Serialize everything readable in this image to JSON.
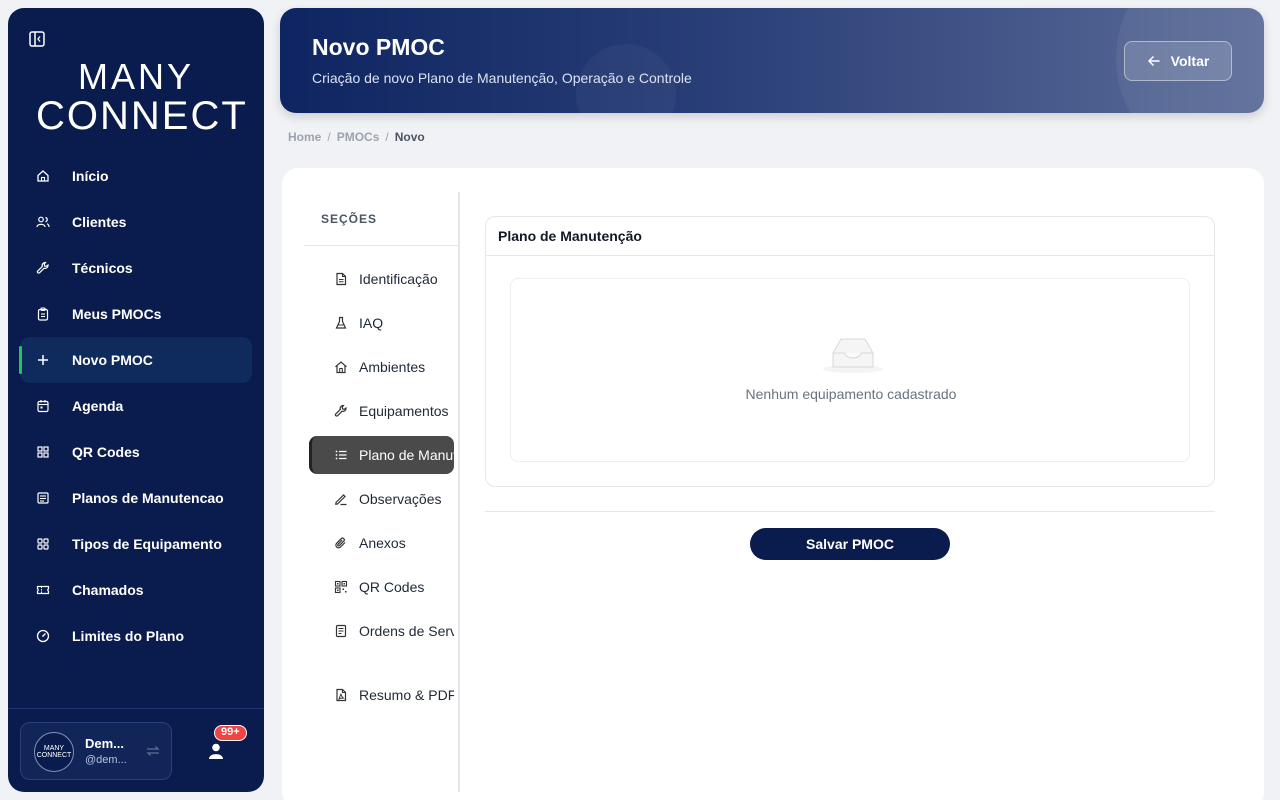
{
  "sidebar": {
    "logo": {
      "line1": "MANY",
      "line2": "CONNECT"
    },
    "nav": [
      {
        "label": "Início",
        "icon": "home-icon"
      },
      {
        "label": "Clientes",
        "icon": "users-icon"
      },
      {
        "label": "Técnicos",
        "icon": "wrench-icon"
      },
      {
        "label": "Meus PMOCs",
        "icon": "clipboard-icon"
      },
      {
        "label": "Novo PMOC",
        "icon": "plus-icon",
        "active": true
      },
      {
        "label": "Agenda",
        "icon": "calendar-icon"
      },
      {
        "label": "QR Codes",
        "icon": "qr-grid-icon"
      },
      {
        "label": "Planos de Manutencao",
        "icon": "list-icon"
      },
      {
        "label": "Tipos de Equipamento",
        "icon": "grid-icon"
      },
      {
        "label": "Chamados",
        "icon": "ticket-icon"
      },
      {
        "label": "Limites do Plano",
        "icon": "gauge-icon"
      }
    ],
    "user": {
      "avatar_line1": "MANY",
      "avatar_line2": "CONNECT",
      "name": "Dem...",
      "handle": "@dem...",
      "notifications": "99+"
    }
  },
  "header": {
    "title": "Novo PMOC",
    "subtitle": "Criação de novo Plano de Manutenção, Operação e Controle",
    "back_label": "Voltar"
  },
  "breadcrumb": {
    "home": "Home",
    "pmocs": "PMOCs",
    "current": "Novo",
    "sep": "/"
  },
  "sections": {
    "title": "SEÇÕES",
    "items": [
      {
        "label": "Identificação",
        "icon": "document-icon"
      },
      {
        "label": "IAQ",
        "icon": "flask-icon"
      },
      {
        "label": "Ambientes",
        "icon": "home-icon"
      },
      {
        "label": "Equipamentos",
        "icon": "wrench-icon"
      },
      {
        "label": "Plano de Manutenção",
        "icon": "list-icon",
        "active": true
      },
      {
        "label": "Observações",
        "icon": "pencil-icon"
      },
      {
        "label": "Anexos",
        "icon": "paperclip-icon"
      },
      {
        "label": "QR Codes",
        "icon": "qr-grid-icon"
      },
      {
        "label": "Ordens de Serviço",
        "icon": "receipt-icon"
      },
      {
        "label": "Resumo & PDF",
        "icon": "pdf-icon"
      }
    ]
  },
  "main": {
    "card_title": "Plano de Manutenção",
    "empty_text": "Nenhum equipamento cadastrado",
    "save_label": "Salvar PMOC"
  },
  "colors": {
    "navy": "#0a1c4e",
    "accent_green": "#22c55e",
    "badge_red": "#ef4444"
  }
}
